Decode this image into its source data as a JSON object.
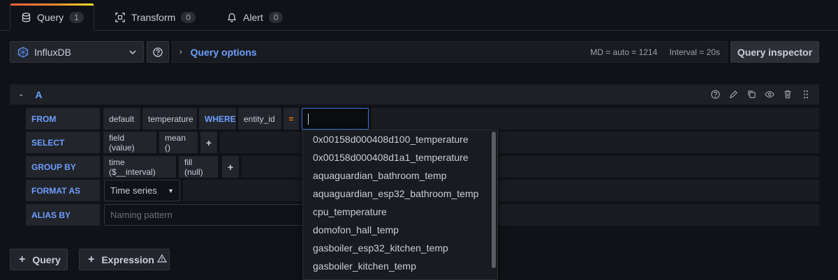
{
  "tabs": [
    {
      "label": "Query",
      "count": "1",
      "icon": "database-icon"
    },
    {
      "label": "Transform",
      "count": "0",
      "icon": "transform-icon"
    },
    {
      "label": "Alert",
      "count": "0",
      "icon": "bell-icon"
    }
  ],
  "datasource": {
    "name": "InfluxDB",
    "icon": "influxdb-icon"
  },
  "query_options": {
    "title": "Query options",
    "md": "MD = auto = 1214",
    "interval": "Interval = 20s"
  },
  "inspector_label": "Query inspector",
  "query": {
    "name": "A",
    "from": {
      "label": "FROM",
      "policy": "default",
      "measurement": "temperature",
      "where_kw": "WHERE",
      "tag": "entity_id",
      "operator": "="
    },
    "select": {
      "label": "SELECT",
      "field": "field (value)",
      "fn": "mean ()"
    },
    "group_by": {
      "label": "GROUP BY",
      "time": "time ($__interval)",
      "fill": "fill (null)"
    },
    "format_as": {
      "label": "FORMAT AS",
      "value": "Time series"
    },
    "alias_by": {
      "label": "ALIAS BY",
      "placeholder": "Naming pattern"
    }
  },
  "dropdown_options": [
    "0x00158d000408d100_temperature",
    "0x00158d000408d1a1_temperature",
    "aquaguardian_bathroom_temp",
    "aquaguardian_esp32_bathroom_temp",
    "cpu_temperature",
    "domofon_hall_temp",
    "gasboiler_esp32_kitchen_temp",
    "gasboiler_kitchen_temp"
  ],
  "bottom": {
    "add_query": "Query",
    "add_expression": "Expression"
  },
  "colors": {
    "accent_blue": "#6e9fff",
    "operator_orange": "#ff780a",
    "focus_border": "#3d71d9"
  }
}
